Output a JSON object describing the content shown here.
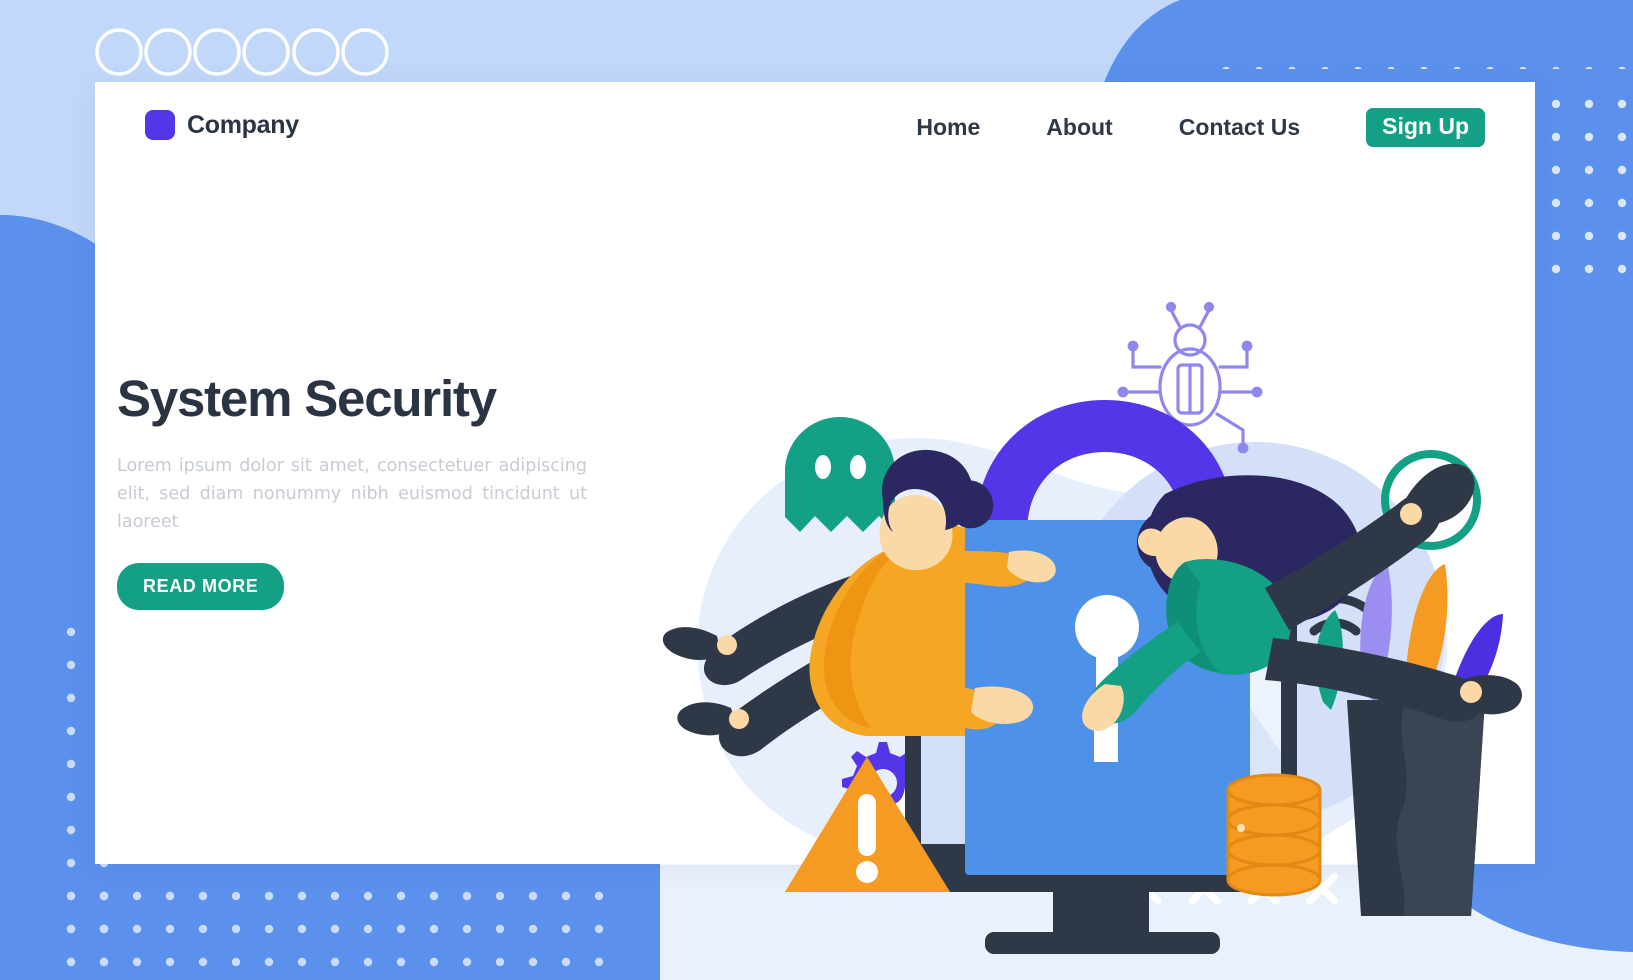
{
  "page": {
    "title": "System Security Landing Page"
  },
  "brand": {
    "name": "Company",
    "mark_icon": "square-logo-icon",
    "mark_color": "#5435e8"
  },
  "nav": {
    "items": [
      {
        "label": "Home"
      },
      {
        "label": "About"
      },
      {
        "label": "Contact Us"
      }
    ],
    "signup_label": "Sign Up",
    "signup_color": "#13a085"
  },
  "hero": {
    "title": "System Security",
    "subtitle": "Lorem ipsum dolor sit amet, consectetuer adipiscing elit, sed diam nonummy nibh euismod tincidunt ut laoreet",
    "cta_label": "READ MORE",
    "cta_color": "#13a085",
    "title_color": "#2b3442",
    "subtitle_color": "#c7ccd3"
  },
  "illustration": {
    "alt": "Two people securing a computer protected by a giant padlock",
    "elements": [
      {
        "name": "padlock",
        "colors": {
          "shackle": "#5435e8",
          "body": "#4d91e8",
          "keyhole": "#ffffff"
        }
      },
      {
        "name": "monitor",
        "colors": {
          "frame": "#2f3847",
          "screen": "#dbe6fb"
        }
      },
      {
        "name": "ghost-icon",
        "color": "#13a085"
      },
      {
        "name": "bug-icon",
        "color": "#8f86ee"
      },
      {
        "name": "gear-icon",
        "color": "#5435e8"
      },
      {
        "name": "warning-triangle-icon",
        "color": "#f59a23"
      },
      {
        "name": "database-icon",
        "color": "#f59a23"
      },
      {
        "name": "wifi-icon",
        "color": "#2f3847"
      },
      {
        "name": "circle-outline",
        "color": "#13a085"
      },
      {
        "name": "sparkle-icon",
        "color": "#ffffff"
      },
      {
        "name": "plant",
        "colors": {
          "vase": "#2f3847",
          "leaf_teal": "#13a085",
          "leaf_purple": "#9b8ef0",
          "leaf_orange": "#f59a23",
          "leaf_blue": "#4b2fe0"
        }
      },
      {
        "name": "man-character",
        "colors": {
          "shirt": "#f5a623",
          "pants": "#2f3847",
          "hair": "#2b2861",
          "skin": "#fbd9a6"
        }
      },
      {
        "name": "woman-character",
        "colors": {
          "shirt": "#13a085",
          "pants": "#2f3847",
          "hair": "#2b2861",
          "skin": "#fbd9a6"
        }
      }
    ]
  },
  "decor": {
    "top_circles_count": 6,
    "top_circles_color": "#ffffff",
    "dot_color_light": "#c8daf9",
    "dot_color_blue": "#d6e4fb",
    "x_marks_count": 6,
    "x_marks_color": "#ffffff",
    "bg_blue": "#5b91ec",
    "bg_light_blue": "#c2d8fa",
    "bg_pale": "#eaf1fd"
  }
}
